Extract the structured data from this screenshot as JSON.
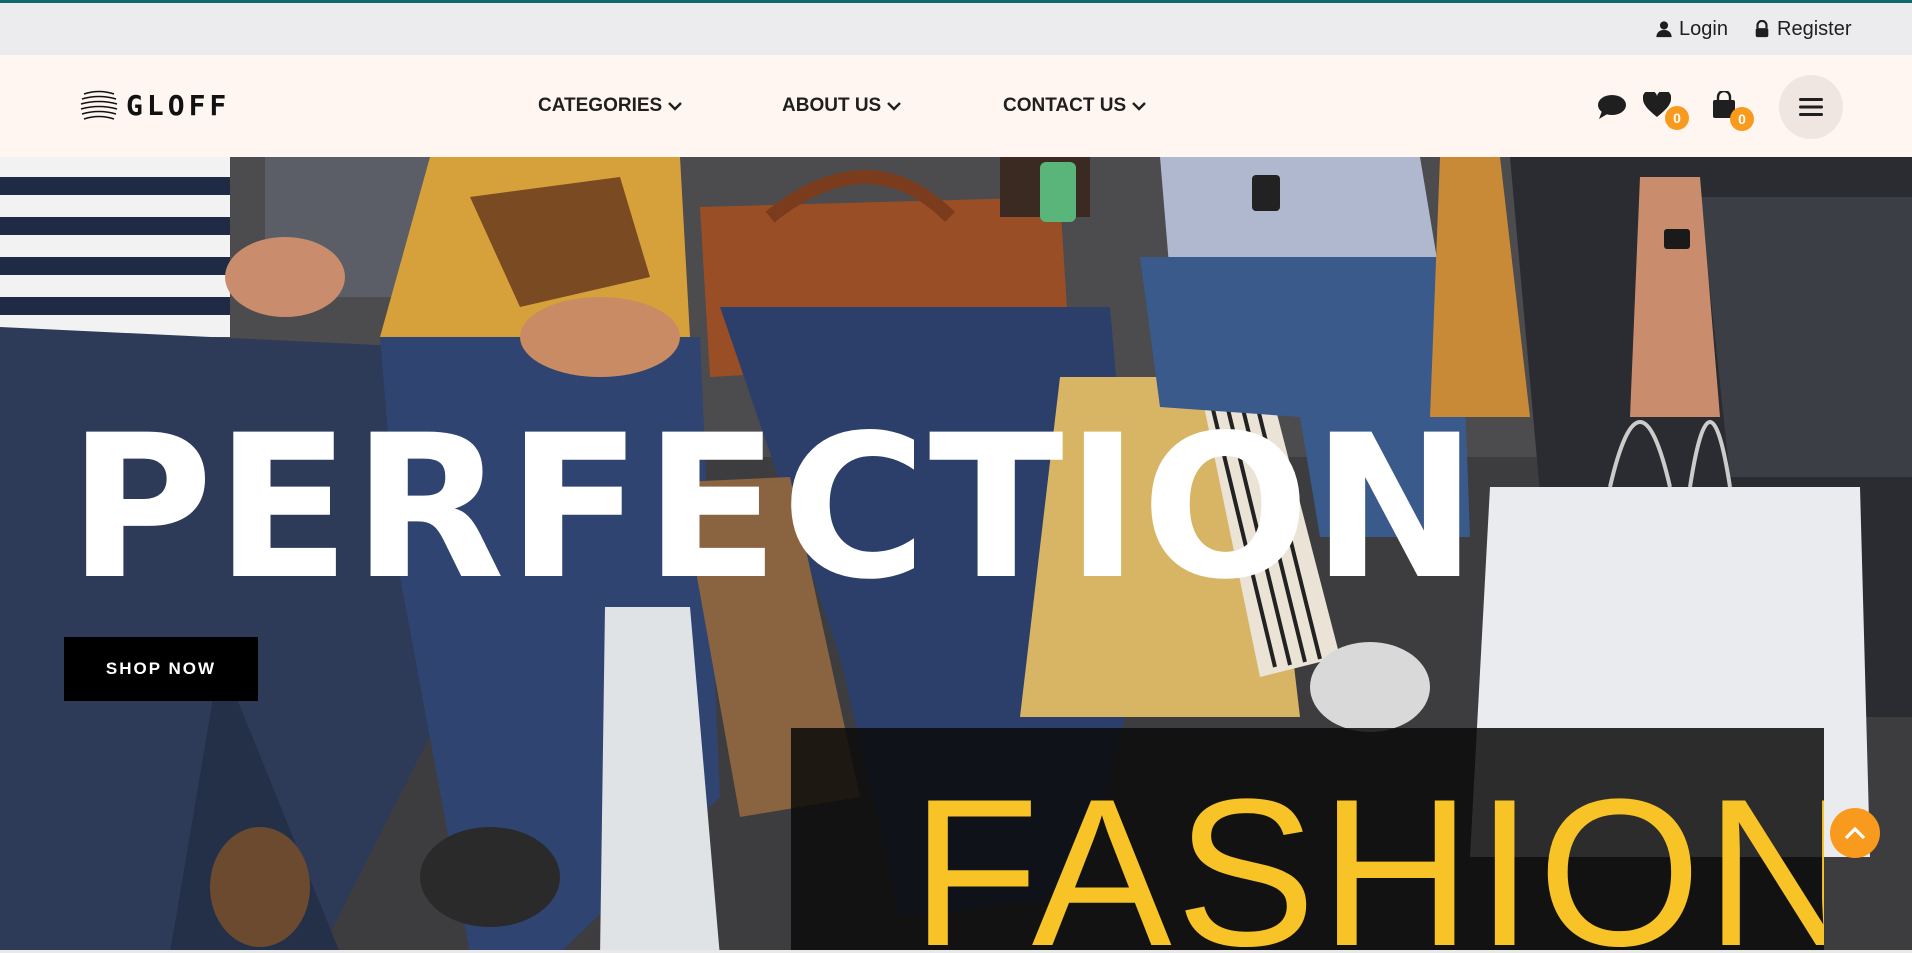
{
  "topbar": {
    "login_label": "Login",
    "register_label": "Register"
  },
  "brand": {
    "logo_text": "GLOFF"
  },
  "nav": {
    "items": [
      {
        "label": "CATEGORIES",
        "icon": "chevron-down-icon"
      },
      {
        "label": "ABOUT US",
        "icon": "chevron-down-icon"
      },
      {
        "label": "CONTACT US",
        "icon": "chevron-down-icon"
      }
    ]
  },
  "header_icons": {
    "chat_icon": "chat-bubble-icon",
    "wishlist_count": "0",
    "cart_count": "0",
    "menu_icon": "hamburger-menu-icon"
  },
  "hero": {
    "headline": "PERFECTION",
    "cta_label": "SHOP NOW",
    "banner_text": "FASHION"
  },
  "colors": {
    "accent_orange": "#f79a1e",
    "fashion_yellow": "#f8c326",
    "top_line_teal": "#0f6b6b",
    "nav_bg": "#fff6f2"
  }
}
